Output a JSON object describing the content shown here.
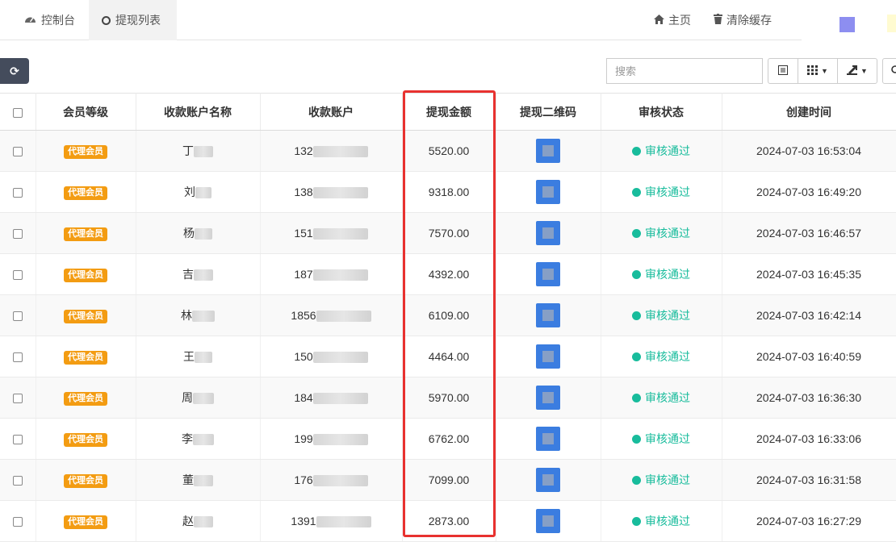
{
  "tabs": [
    {
      "label": "控制台",
      "icon": "dashboard-icon"
    },
    {
      "label": "提现列表",
      "icon": "circle-icon"
    }
  ],
  "nav": {
    "home": "主页",
    "clear_cache": "清除缓存"
  },
  "colors": {
    "accent_purple": "#8d8ef0",
    "badge": "#f39c12",
    "status_green": "#18bc9c",
    "highlight": "#e8312f"
  },
  "search": {
    "placeholder": "搜索"
  },
  "table": {
    "headers": [
      "会员等级",
      "收款账户名称",
      "收款账户",
      "提现金额",
      "提现二维码",
      "审核状态",
      "创建时间"
    ],
    "rows": [
      {
        "level": "代理会员",
        "name": "丁",
        "account": "132",
        "amount": "5520.00",
        "status": "审核通过",
        "created": "2024-07-03 16:53:04"
      },
      {
        "level": "代理会员",
        "name": "刘",
        "account": "138",
        "amount": "9318.00",
        "status": "审核通过",
        "created": "2024-07-03 16:49:20"
      },
      {
        "level": "代理会员",
        "name": "杨",
        "account": "151",
        "amount": "7570.00",
        "status": "审核通过",
        "created": "2024-07-03 16:46:57"
      },
      {
        "level": "代理会员",
        "name": "吉",
        "account": "187",
        "amount": "4392.00",
        "status": "审核通过",
        "created": "2024-07-03 16:45:35"
      },
      {
        "level": "代理会员",
        "name": "林",
        "account": "1856",
        "amount": "6109.00",
        "status": "审核通过",
        "created": "2024-07-03 16:42:14"
      },
      {
        "level": "代理会员",
        "name": "王",
        "account": "150",
        "amount": "4464.00",
        "status": "审核通过",
        "created": "2024-07-03 16:40:59"
      },
      {
        "level": "代理会员",
        "name": "周",
        "account": "184",
        "amount": "5970.00",
        "status": "审核通过",
        "created": "2024-07-03 16:36:30"
      },
      {
        "level": "代理会员",
        "name": "李",
        "account": "199",
        "amount": "6762.00",
        "status": "审核通过",
        "created": "2024-07-03 16:33:06"
      },
      {
        "level": "代理会员",
        "name": "董",
        "account": "176",
        "amount": "7099.00",
        "status": "审核通过",
        "created": "2024-07-03 16:31:58"
      },
      {
        "level": "代理会员",
        "name": "赵",
        "account": "1391",
        "amount": "2873.00",
        "status": "审核通过",
        "created": "2024-07-03 16:27:29"
      }
    ]
  }
}
